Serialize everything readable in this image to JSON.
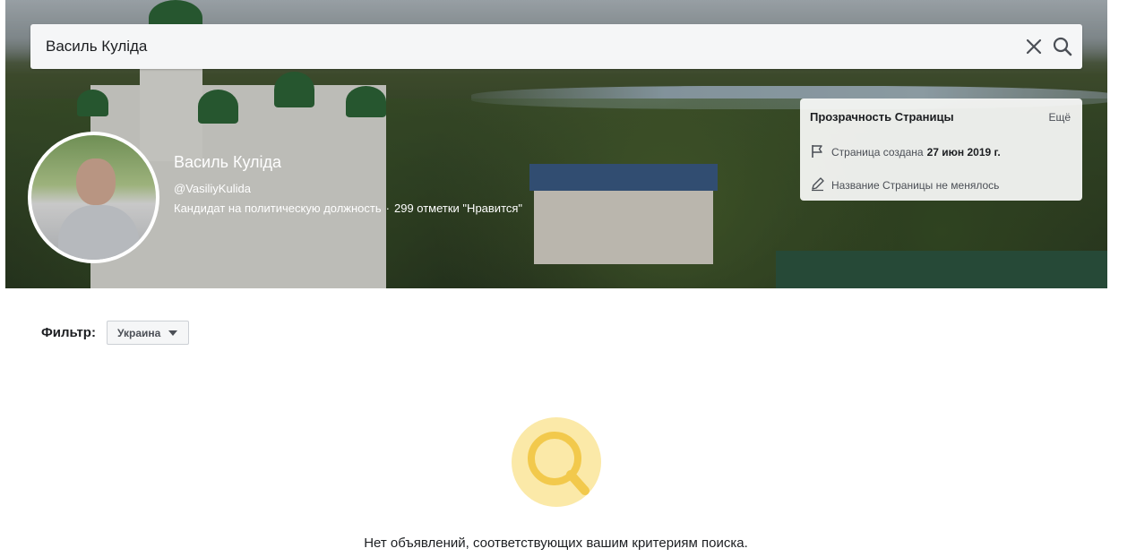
{
  "search": {
    "query": "Василь Куліда"
  },
  "page": {
    "name": "Василь Куліда",
    "handle": "@VasiliyKulida",
    "category": "Кандидат на политическую должность",
    "separator": "·",
    "likes": "299 отметки \"Нравится\""
  },
  "transparency": {
    "title": "Прозрачность Страницы",
    "more": "Ещё",
    "created_label": "Страница создана",
    "created_date": "27 июн 2019 г.",
    "name_changes": "Название Страницы не менялось"
  },
  "filter": {
    "label": "Фильтр:",
    "selected": "Украина"
  },
  "empty_state": {
    "message": "Нет объявлений, соответствующих вашим критериям поиска."
  },
  "colors": {
    "accent_yellow": "#f2c94c",
    "accent_yellow_light": "#fbe9a8"
  },
  "icons": [
    "close-icon",
    "search-icon",
    "flag-icon",
    "pencil-icon",
    "chevron-down-icon",
    "magnifier-icon"
  ]
}
